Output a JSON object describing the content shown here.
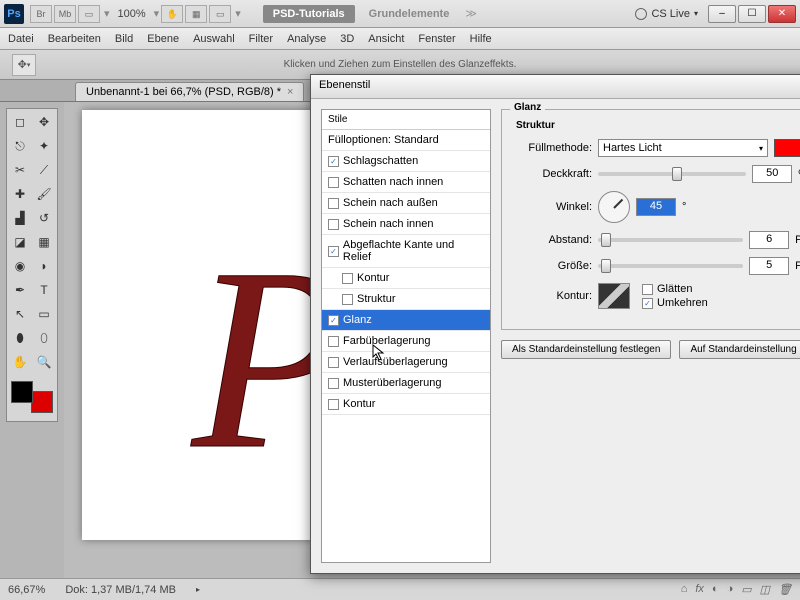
{
  "titlebar": {
    "zoom": "100%",
    "tab_psd": "PSD-Tutorials",
    "tab_grund": "Grundelemente",
    "cslive": "CS Live"
  },
  "menu": [
    "Datei",
    "Bearbeiten",
    "Bild",
    "Ebene",
    "Auswahl",
    "Filter",
    "Analyse",
    "3D",
    "Ansicht",
    "Fenster",
    "Hilfe"
  ],
  "opt_hint": "Klicken und Ziehen zum Einstellen des Glanzeffekts.",
  "doc_tab": "Unbenannt-1 bei 66,7% (PSD, RGB/8) *",
  "status": {
    "zoom": "66,67%",
    "dok": "Dok: 1,37 MB/1,74 MB"
  },
  "dialog": {
    "title": "Ebenenstil",
    "left_hdr": "Stile",
    "fill_opts": "Fülloptionen: Standard",
    "styles": [
      {
        "label": "Schlagschatten",
        "checked": true,
        "indent": false
      },
      {
        "label": "Schatten nach innen",
        "checked": false,
        "indent": false
      },
      {
        "label": "Schein nach außen",
        "checked": false,
        "indent": false
      },
      {
        "label": "Schein nach innen",
        "checked": false,
        "indent": false
      },
      {
        "label": "Abgeflachte Kante und Relief",
        "checked": true,
        "indent": false
      },
      {
        "label": "Kontur",
        "checked": false,
        "indent": true
      },
      {
        "label": "Struktur",
        "checked": false,
        "indent": true
      },
      {
        "label": "Glanz",
        "checked": true,
        "indent": false,
        "selected": true
      },
      {
        "label": "Farbüberlagerung",
        "checked": false,
        "indent": false
      },
      {
        "label": "Verlaufsüberlagerung",
        "checked": false,
        "indent": false
      },
      {
        "label": "Musterüberlagerung",
        "checked": false,
        "indent": false
      },
      {
        "label": "Kontur",
        "checked": false,
        "indent": false
      }
    ],
    "group_glanz": "Glanz",
    "group_struktur": "Struktur",
    "lbl_fuell": "Füllmethode:",
    "val_fuell": "Hartes Licht",
    "lbl_deck": "Deckkraft:",
    "val_deck": "50",
    "unit_pct": "%",
    "lbl_winkel": "Winkel:",
    "val_winkel": "45",
    "unit_deg": "°",
    "lbl_abstand": "Abstand:",
    "val_abstand": "6",
    "unit_px": "Px",
    "lbl_groesse": "Größe:",
    "val_groesse": "5",
    "lbl_kontur": "Kontur:",
    "chk_glaetten": "Glätten",
    "chk_umkehren": "Umkehren",
    "btn_std": "Als Standardeinstellung festlegen",
    "btn_reset": "Auf Standardeinstellung",
    "color": "#ff0000"
  }
}
